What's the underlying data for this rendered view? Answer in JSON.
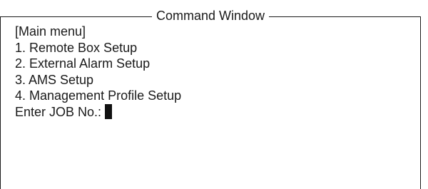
{
  "window": {
    "title": "Command Window"
  },
  "menu": {
    "header": "[Main menu]",
    "items": [
      {
        "label": "1. Remote Box Setup"
      },
      {
        "label": "2. External Alarm Setup"
      },
      {
        "label": "3. AMS Setup"
      },
      {
        "label": "4. Management Profile Setup"
      }
    ]
  },
  "prompt": {
    "label": "Enter JOB No.:",
    "value": ""
  }
}
